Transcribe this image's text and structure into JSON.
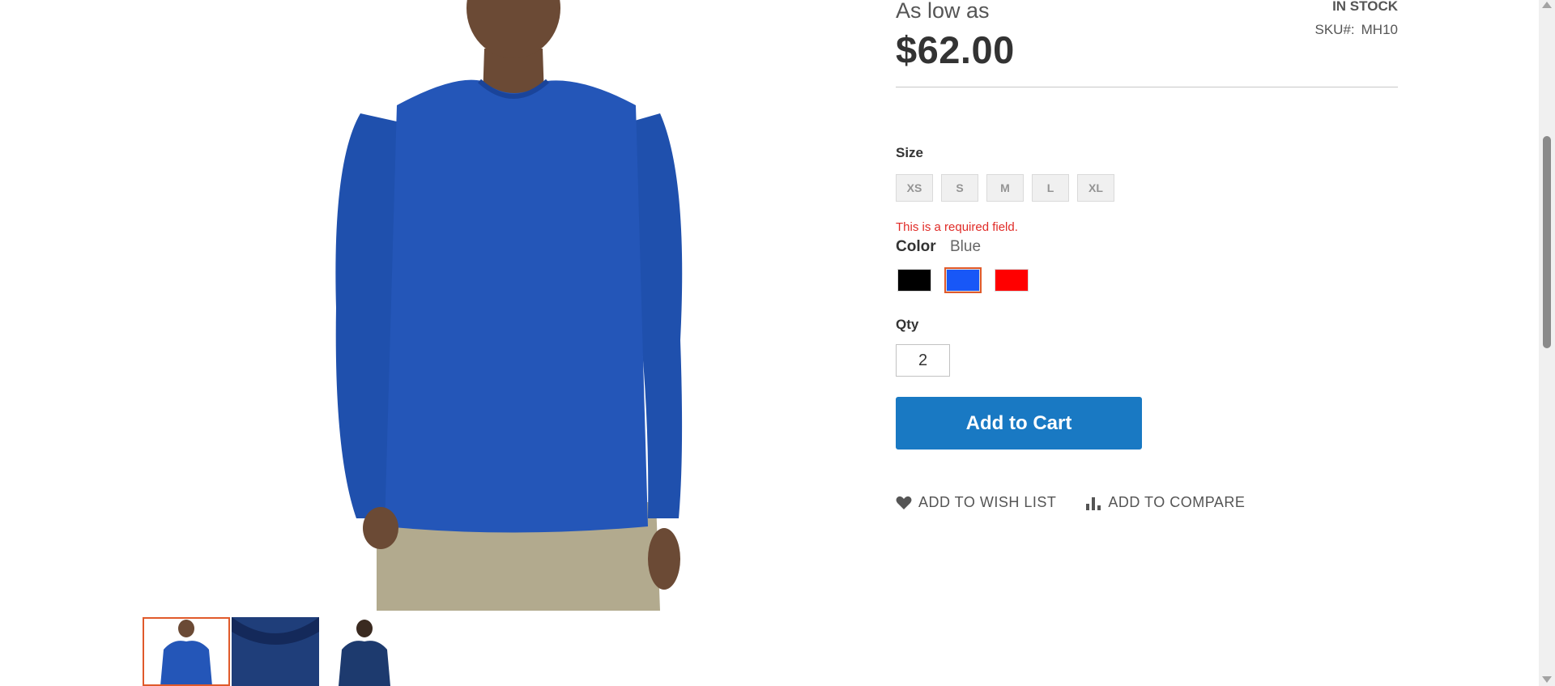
{
  "product": {
    "as_low_as": "As low as",
    "price": "$62.00",
    "stock": "IN STOCK",
    "sku_label": "SKU#:",
    "sku": "MH10"
  },
  "gallery": {
    "main_image": "blue-long-sleeve-shirt-model-front",
    "thumbnails": [
      {
        "name": "blue-shirt-front",
        "active": true
      },
      {
        "name": "blue-shirt-fabric-detail",
        "active": false
      },
      {
        "name": "blue-shirt-back",
        "active": false
      }
    ]
  },
  "size": {
    "label": "Size",
    "options": [
      "XS",
      "S",
      "M",
      "L",
      "XL"
    ]
  },
  "validation": {
    "error": "This is a required field."
  },
  "color": {
    "label": "Color",
    "selected": "Blue",
    "options": [
      {
        "name": "Black",
        "hex": "#000000",
        "selected": false
      },
      {
        "name": "Blue",
        "hex": "#1857f7",
        "selected": true
      },
      {
        "name": "Red",
        "hex": "#ff0000",
        "selected": false
      }
    ]
  },
  "qty": {
    "label": "Qty",
    "value": "2"
  },
  "cart": {
    "button": "Add to Cart",
    "color": "#1979c3"
  },
  "actions": {
    "wishlist": "Add to Wish List",
    "compare": "Add to Compare"
  },
  "accent": "#e05a2b"
}
